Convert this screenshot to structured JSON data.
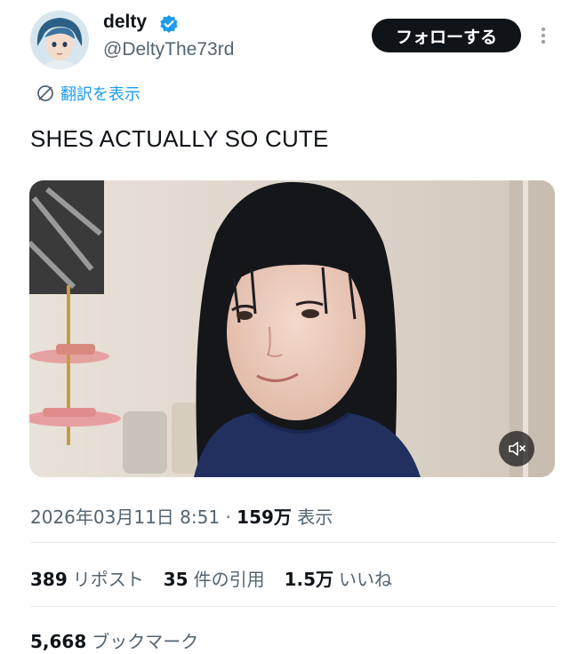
{
  "author": {
    "name": "delty",
    "handle": "@DeltyThe73rd",
    "verified": true,
    "verified_color": "#1d9bf0"
  },
  "follow_label": "フォローする",
  "translate_label": "翻訳を表示",
  "tweet_text": "SHES ACTUALLY SO CUTE",
  "meta": {
    "datetime": "2026年03月11日 8:51",
    "separator": "·",
    "views_count": "159万",
    "views_label": "表示"
  },
  "stats": {
    "reposts_count": "389",
    "reposts_label": "リポスト",
    "quotes_count": "35",
    "quotes_label": "件の引用",
    "likes_count": "1.5万",
    "likes_label": "いいね",
    "bookmarks_count": "5,668",
    "bookmarks_label": "ブックマーク"
  },
  "icons": {
    "more": "more-vertical-icon",
    "translate": "globe-slash-icon",
    "mute": "speaker-muted-icon",
    "verified": "verified-badge-icon"
  }
}
